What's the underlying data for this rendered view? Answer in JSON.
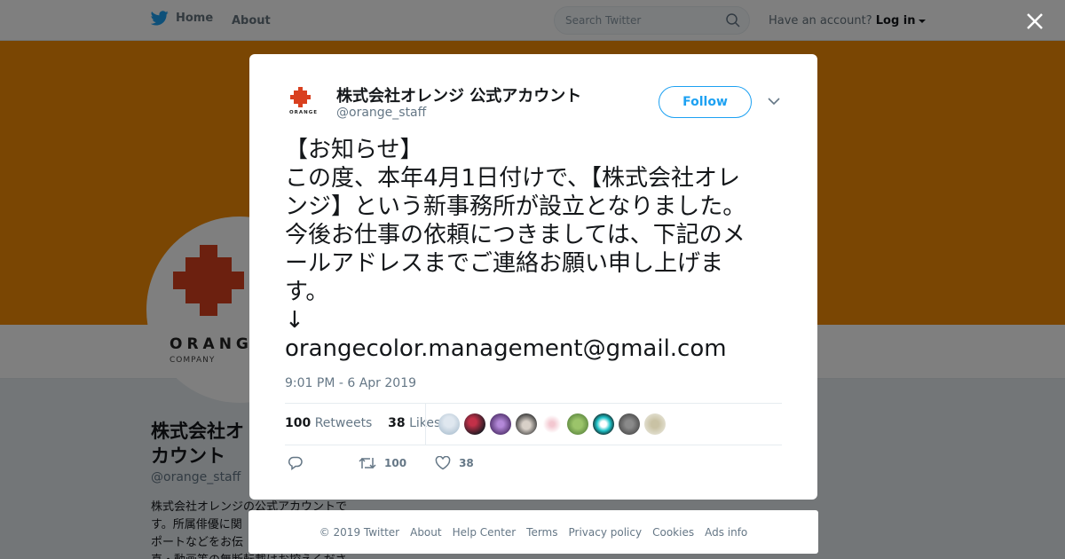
{
  "topbar": {
    "home_label": "Home",
    "about_label": "About",
    "search_placeholder": "Search Twitter",
    "account_prompt": "Have an account?",
    "login_label": "Log in"
  },
  "profile": {
    "name": "株式会社オレンジ 公式アカウント",
    "name_visible_lines": [
      "株式会社オ",
      "カウント"
    ],
    "handle": "@orange_staff",
    "bio_lines": [
      "株式会社オレンジの公式アカウントで",
      "す。所属俳優に関",
      "ポートなどをお伝",
      "真・動画等の無断転載はお控えくださ"
    ],
    "logo_text": "ORANGE",
    "logo_subtext": "COMPANY",
    "banner_color": "#f48c06"
  },
  "tweet": {
    "author_name": "株式会社オレンジ 公式アカウント",
    "author_handle": "@orange_staff",
    "follow_label": "Follow",
    "text_lines": [
      "【お知らせ】",
      "この度、本年4月1日付けで、【株式会社オレ",
      "ンジ】という新事務所が設立となりました。",
      "今後お仕事の依頼につきましては、下記のメ",
      "ールアドレスまでご連絡お願い申し上げま",
      "す。",
      "↓",
      "orangecolor.management@gmail.com"
    ],
    "timestamp": "9:01 PM - 6 Apr 2019",
    "retweet_count": "100",
    "retweet_label": "Retweets",
    "like_count": "38",
    "like_label": "Likes",
    "action_retweets": "100",
    "action_likes": "38"
  },
  "footer": {
    "links": [
      "© 2019 Twitter",
      "About",
      "Help Center",
      "Terms",
      "Privacy policy",
      "Cookies",
      "Ads info"
    ]
  },
  "colors": {
    "brand_blue": "#1da1f2",
    "orange": "#f48c06",
    "logo_red": "#d9401f"
  },
  "icons": [
    "twitter-bird-icon",
    "search-icon",
    "close-icon",
    "chevron-down-icon",
    "reply-icon",
    "retweet-icon",
    "like-icon"
  ]
}
